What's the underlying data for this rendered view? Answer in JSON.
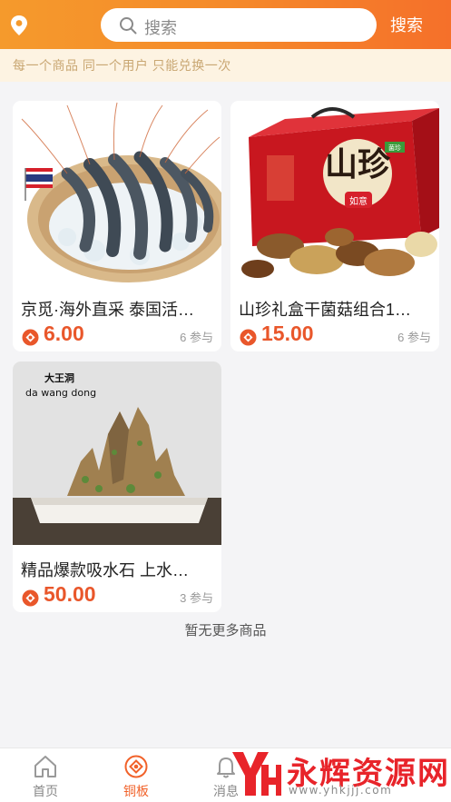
{
  "header": {
    "location_icon": "location-pin-icon",
    "search": {
      "placeholder": "搜索",
      "icon": "search-icon"
    },
    "search_button": "搜索",
    "gradient_colors": [
      "#f59a2c",
      "#f5702a"
    ]
  },
  "notice": {
    "text": "每一个商品 同一个用户 只能兑换一次"
  },
  "products": [
    {
      "title": "京觅·海外直采 泰国活…",
      "price": "6.00",
      "participants": "6 参与",
      "image": "shrimp-basket-image"
    },
    {
      "title": "山珍礼盒干菌菇组合1…",
      "price": "15.00",
      "participants": "6 参与",
      "image": "mushroom-giftbox-image",
      "image_text": {
        "box_brand": "山珍",
        "box_badge": "如意",
        "box_tag": "菌珍"
      }
    },
    {
      "title": "精品爆款吸水石 上水…",
      "price": "50.00",
      "participants": "3 参与",
      "image": "rock-bonsai-image",
      "image_text": {
        "caption_cn": "大王洞",
        "caption_en": "da wang dong"
      }
    }
  ],
  "no_more_text": "暂无更多商品",
  "tabbar": {
    "tabs": [
      {
        "label": "首页",
        "icon": "home-icon",
        "active": false
      },
      {
        "label": "铜板",
        "icon": "coin-tab-icon",
        "active": true
      },
      {
        "label": "消息",
        "icon": "bell-icon",
        "active": false
      }
    ],
    "active_color": "#f1622a"
  },
  "watermark": {
    "title": "永辉资源网",
    "url": "www.yhkjjj.com"
  },
  "colors": {
    "price": "#e9572b",
    "accent": "#f58a2a",
    "notice_bg": "#fdf3e2"
  }
}
